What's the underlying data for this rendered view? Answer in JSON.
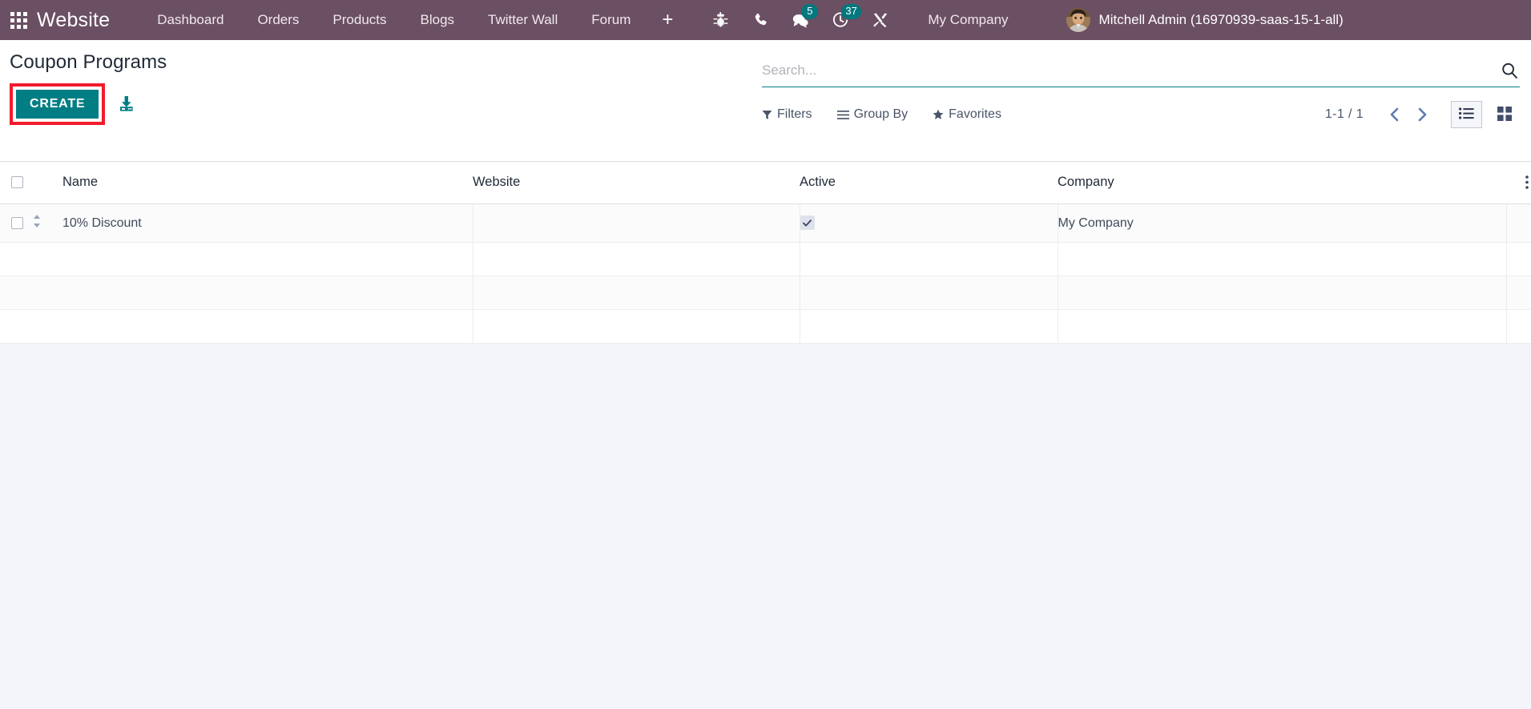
{
  "navbar": {
    "apps_icon": "apps-grid-icon",
    "brand": "Website",
    "menu": [
      {
        "label": "Dashboard"
      },
      {
        "label": "Orders"
      },
      {
        "label": "Products"
      },
      {
        "label": "Blogs"
      },
      {
        "label": "Twitter Wall"
      },
      {
        "label": "Forum"
      }
    ],
    "plus_label": "+",
    "sys_icons": [
      {
        "name": "bug-icon",
        "badge": null
      },
      {
        "name": "phone-icon",
        "badge": null
      },
      {
        "name": "messages-icon",
        "badge": "5"
      },
      {
        "name": "activities-clock-icon",
        "badge": "37"
      },
      {
        "name": "tools-icon",
        "badge": null
      }
    ],
    "company": "My Company",
    "user": "Mitchell Admin (16970939-saas-15-1-all)",
    "brand_color": "#6b4f63",
    "badge_color": "#00787d"
  },
  "control_panel": {
    "title": "Coupon Programs",
    "create_label": "CREATE",
    "create_color": "#017e84",
    "highlight_color": "#f21b2c",
    "export_icon": "download-export-icon",
    "search": {
      "placeholder": "Search...",
      "value": "",
      "icon": "search-icon"
    },
    "filters": [
      {
        "label": "Filters",
        "icon": "filter-icon"
      },
      {
        "label": "Group By",
        "icon": "group-by-icon"
      },
      {
        "label": "Favorites",
        "icon": "star-icon"
      }
    ],
    "pager": "1-1 / 1",
    "prev_icon": "chevron-left-icon",
    "next_icon": "chevron-right-icon",
    "views": [
      {
        "name": "list-view",
        "icon": "list-icon",
        "active": true
      },
      {
        "name": "kanban-view",
        "icon": "kanban-grid-icon",
        "active": false
      }
    ]
  },
  "list": {
    "columns": [
      "Name",
      "Website",
      "Active",
      "Company"
    ],
    "options_icon": "options-dots-icon",
    "rows": [
      {
        "name": "10% Discount",
        "website": "",
        "active": true,
        "company": "My Company"
      }
    ],
    "empty_rows": 3
  }
}
